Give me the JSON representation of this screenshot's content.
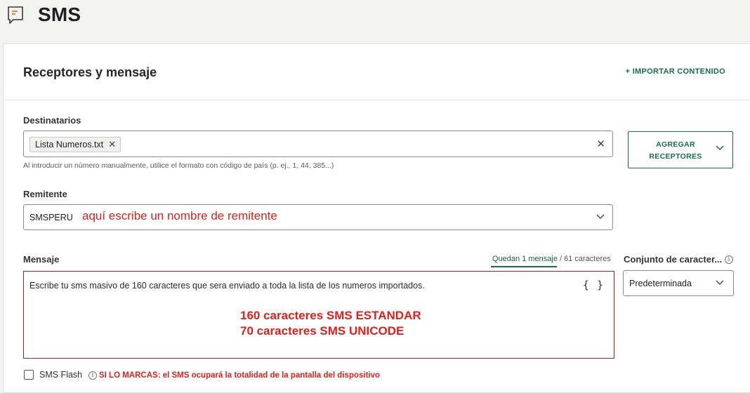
{
  "header": {
    "title": "SMS",
    "icon": "message-square-icon"
  },
  "section": {
    "title": "Receptores y mensaje",
    "import_link": "+ IMPORTAR CONTENIDO"
  },
  "recipients": {
    "label": "Destinatarios",
    "chips": [
      {
        "label": "Lista Numeros.txt",
        "remove_icon": "close-icon"
      }
    ],
    "hint": "Al introducir un número manualmente, utilice el formato con código de país (p. ej., 1, 44, 385...)",
    "add_button": "AGREGAR RECEPTORES"
  },
  "sender": {
    "label": "Remitente",
    "value": "SMSPERU",
    "annotation": "aquí escribe un nombre de remitente"
  },
  "message": {
    "label": "Mensaje",
    "counter_prefix": "Quedan 1 mensaje",
    "counter_suffix": " / 61 caracteres",
    "text": "Escribe tu sms masivo de 160 caracteres que sera enviado a toda la lista de los numeros importados.",
    "variables_glyph": "{ }",
    "annotation_line1": "160 caracteres SMS ESTANDAR",
    "annotation_line2": "70 caracteres SMS UNICODE"
  },
  "charset": {
    "label": "Conjunto de caracter...",
    "value": "Predeterminada"
  },
  "flash": {
    "label": "SMS Flash",
    "checked": false,
    "annotation": "SI LO MARCAS: el SMS ocupará la totalidad de la pantalla del dispositivo"
  },
  "colors": {
    "accent": "#146e4f",
    "annotation": "#e0201b",
    "highlight_border": "#b71c1c"
  }
}
